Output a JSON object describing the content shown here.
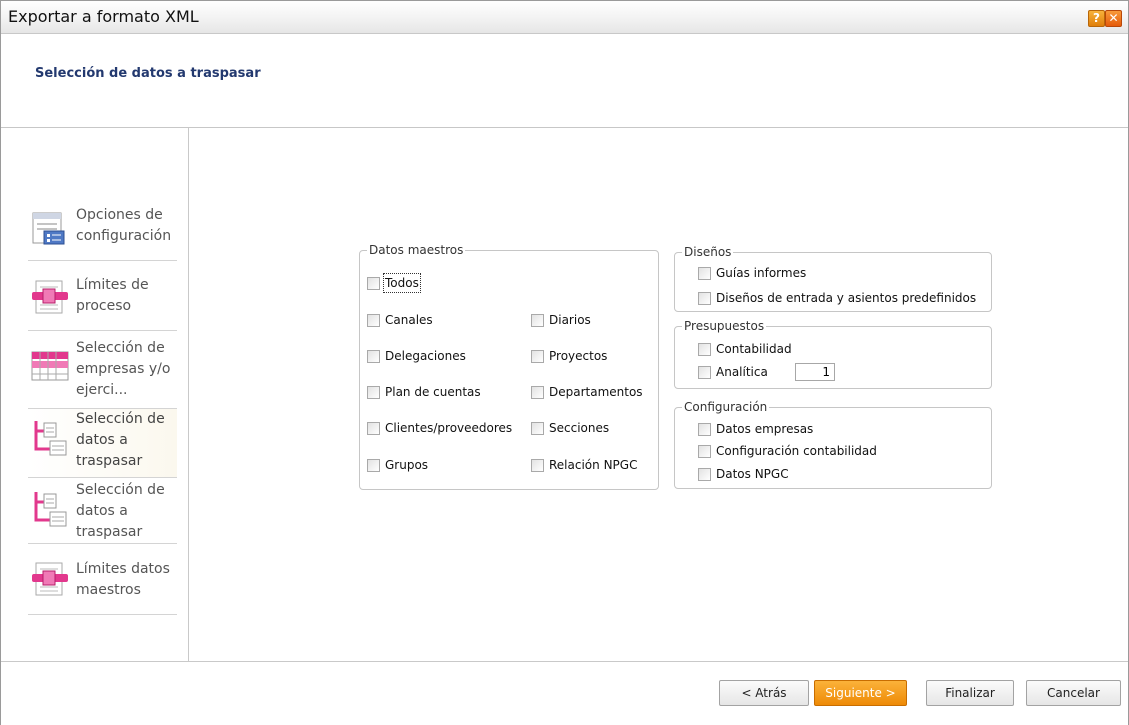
{
  "window": {
    "title": "Exportar a formato XML",
    "help_label": "?",
    "close_label": "✕"
  },
  "header": {
    "title": "Selección de datos a traspasar"
  },
  "sidebar": {
    "items": [
      {
        "label": "Opciones de\nconfiguración",
        "icon": "config-list-icon"
      },
      {
        "label": "Límites de\nproceso",
        "icon": "limits-icon"
      },
      {
        "label": "Selección de\nempresas y/o\nejerci...",
        "icon": "calendar-grid-icon"
      },
      {
        "label": "Selección de\ndatos a\ntraspasar",
        "icon": "data-transfer-icon"
      },
      {
        "label": "Selección de\ndatos a\ntraspasar",
        "icon": "data-transfer-icon"
      },
      {
        "label": "Límites datos\nmaestros",
        "icon": "limits-icon"
      }
    ]
  },
  "groups": {
    "datos_maestros": {
      "label": "Datos maestros",
      "todos": "Todos",
      "left": [
        "Canales",
        "Delegaciones",
        "Plan de cuentas",
        "Clientes/proveedores",
        "Grupos"
      ],
      "right": [
        "Diarios",
        "Proyectos",
        "Departamentos",
        "Secciones",
        "Relación NPGC"
      ]
    },
    "disenos": {
      "label": "Diseños",
      "items": [
        "Guías informes",
        "Diseños de entrada y asientos predefinidos"
      ]
    },
    "presupuestos": {
      "label": "Presupuestos",
      "items": [
        "Contabilidad",
        "Analítica"
      ],
      "analitica_value": "1"
    },
    "configuracion": {
      "label": "Configuración",
      "items": [
        "Datos empresas",
        "Configuración contabilidad",
        "Datos NPGC"
      ]
    }
  },
  "footer": {
    "back": "< Atrás",
    "next": "Siguiente >",
    "finish": "Finalizar",
    "cancel": "Cancelar"
  },
  "colors": {
    "accent": "#23396f",
    "primary_button": "#f39a15"
  }
}
